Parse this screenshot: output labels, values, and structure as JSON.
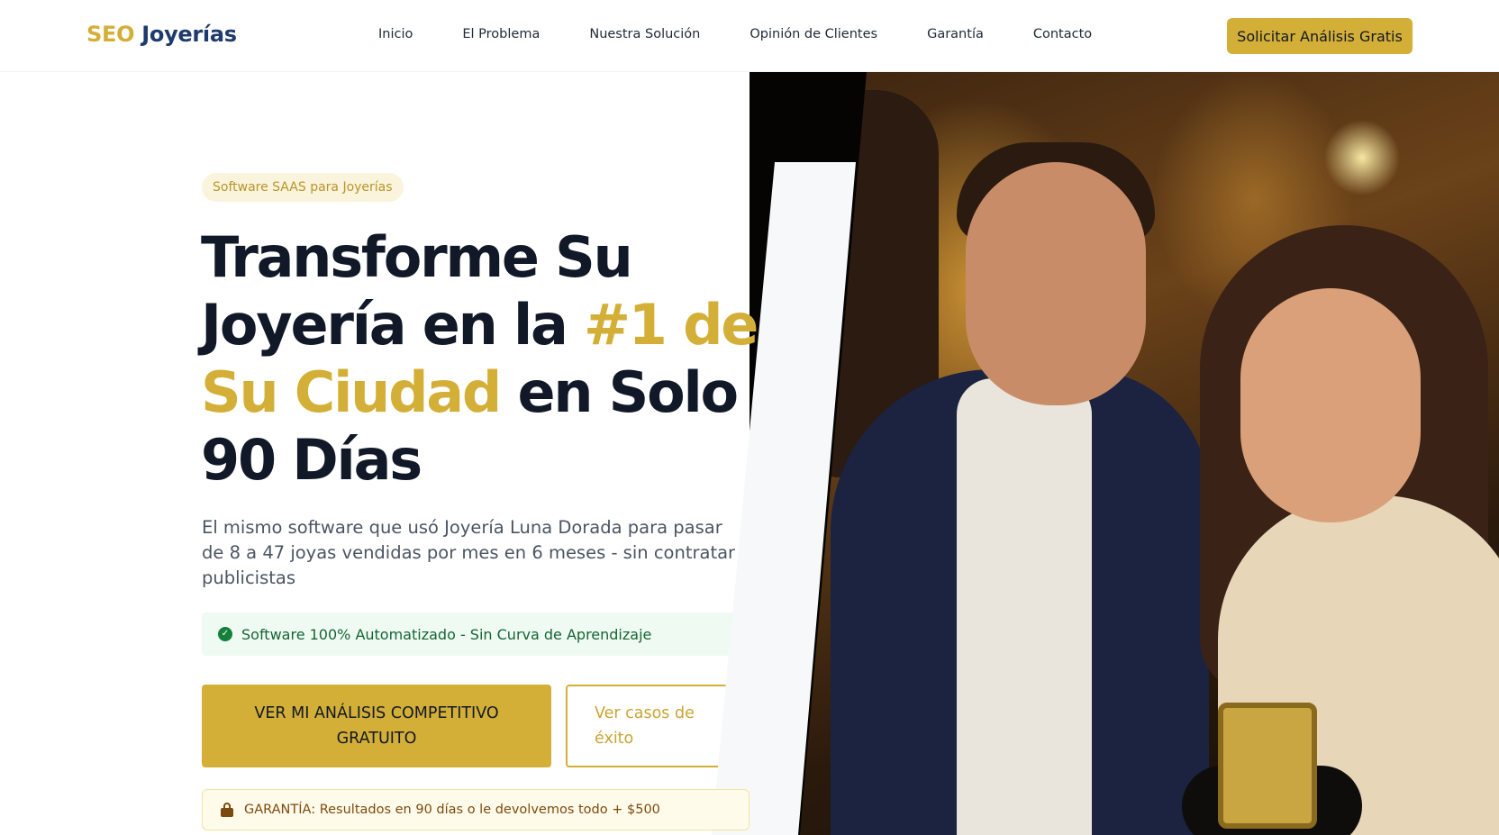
{
  "header": {
    "logo_seo": "SEO",
    "logo_brand": "Joyerías",
    "nav": [
      "Inicio",
      "El Problema",
      "Nuestra Solución",
      "Opinión de Clientes",
      "Garantía",
      "Contacto"
    ],
    "cta": "Solicitar Análisis Gratis"
  },
  "hero": {
    "badge": "Software SAAS para Joyerías",
    "title_part1": "Transforme Su Joyería en la ",
    "title_highlight": "#1 de Su Ciudad",
    "title_part2": " en Solo 90 Días",
    "description": "El mismo software que usó Joyería Luna Dorada para pasar de 8 a 47 joyas vendidas por mes en 6 meses - sin contratar publicistas",
    "feature": "Software 100% Automatizado - Sin Curva de Aprendizaje",
    "primary_button": "VER MI ANÁLISIS COMPETITIVO GRATUITO",
    "secondary_button": "Ver casos de éxito",
    "guarantee": "GARANTÍA: Resultados en 90 días o le devolvemos todo + $500"
  },
  "colors": {
    "accent_gold": "#d4af37",
    "brand_navy": "#1e3a6e",
    "success_green": "#166534"
  },
  "icons": {
    "feature": "check-circle-icon",
    "guarantee": "lock-icon"
  }
}
